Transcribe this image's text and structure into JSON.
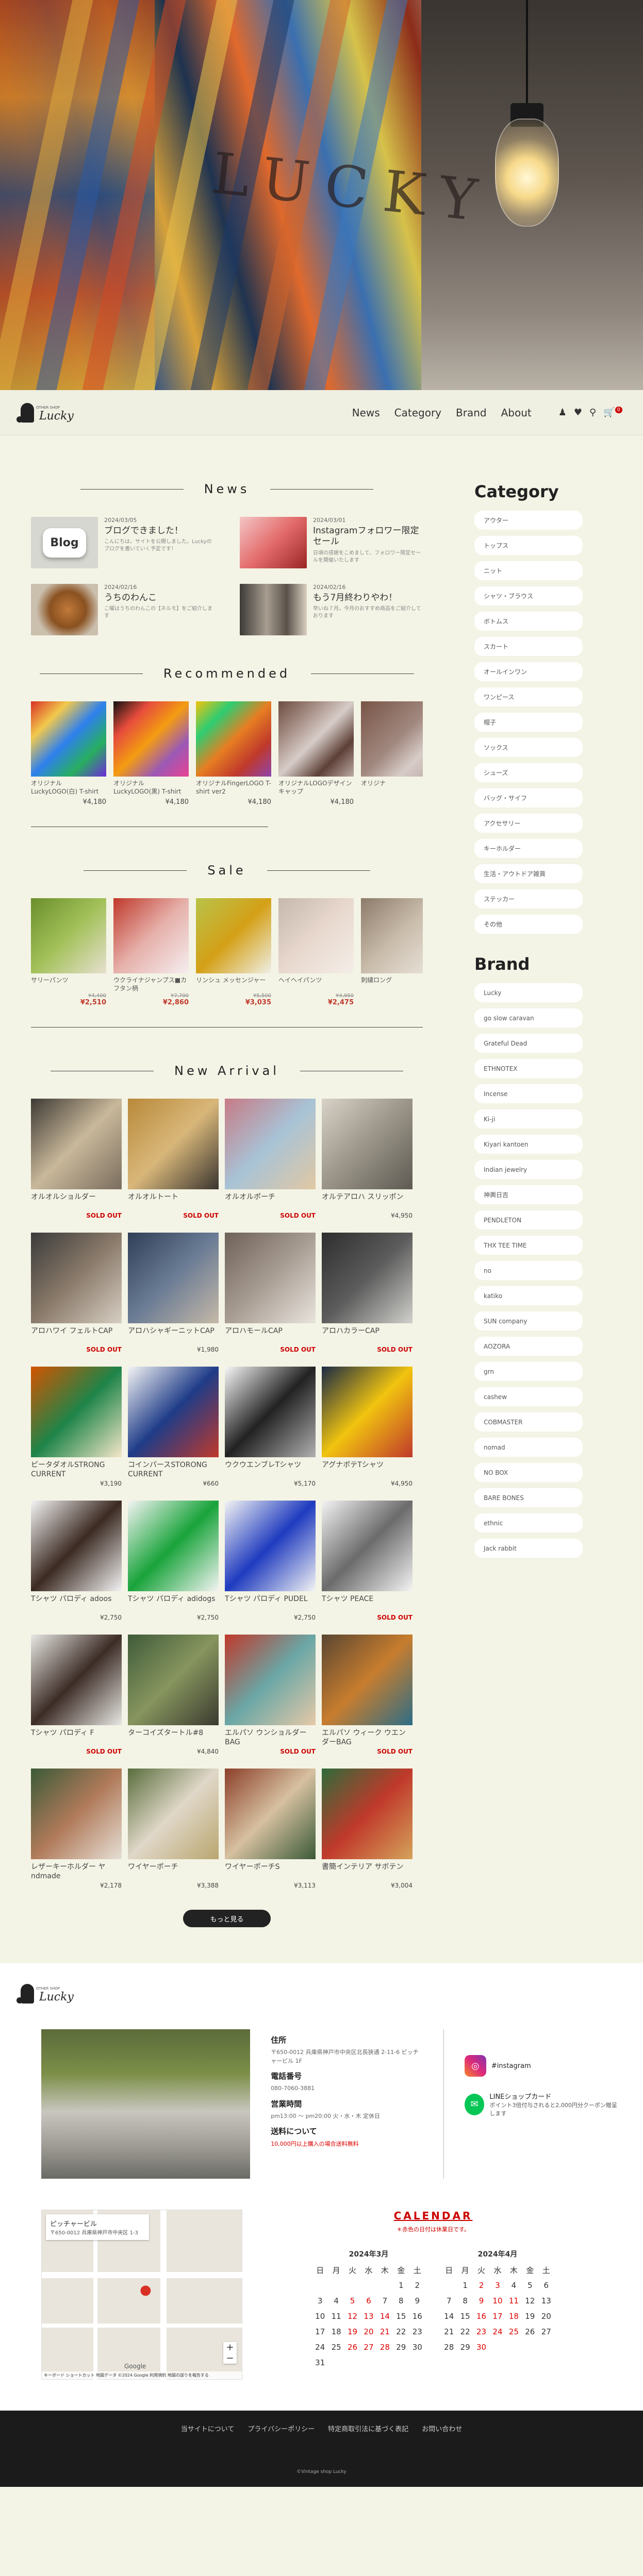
{
  "header": {
    "logo_text": "Lucky",
    "logo_sub": "OTHER SHOP",
    "nav": [
      "News",
      "Category",
      "Brand",
      "About"
    ],
    "cart_count": "0"
  },
  "hero": {
    "wall_text": "LUCKY"
  },
  "news": {
    "title": "News",
    "items": [
      {
        "date": "2024/03/05",
        "title": "ブログできました！",
        "desc": "こんにちは。サイトを公開しました。Luckyのブログを書いていく予定です！",
        "thumb": "blog",
        "thumb_text": "Blog"
      },
      {
        "date": "2024/03/01",
        "title": "Instagramフォロワー限定 セール",
        "desc": "日頃の感謝をこめまして、フォロワー限定セールを開催いたします",
        "thumb": "ig"
      },
      {
        "date": "2024/02/16",
        "title": "うちのわんこ",
        "desc": "こ曜はうちのわんこの【ネルモ】をご紹介します",
        "thumb": "dog"
      },
      {
        "date": "2024/02/16",
        "title": "もう7月終わりやわ！",
        "desc": "早いね７月。今月のおすすめ商品をご紹介しております",
        "thumb": "shop"
      }
    ]
  },
  "recommended": {
    "title": "Recommended",
    "items": [
      {
        "name": "オリジナルLuckyLOGO(白) T-shirt ver2",
        "price": "¥4,180",
        "colors": [
          "#d93025",
          "#f2c94c",
          "#2f80ed",
          "#27ae60",
          "#6c2bd9"
        ]
      },
      {
        "name": "オリジナルLuckyLOGO(黒) T-shirt ver2",
        "price": "¥4,180",
        "colors": [
          "#111",
          "#e74c3c",
          "#f39c12",
          "#9b59b6",
          "#e84393"
        ]
      },
      {
        "name": "オリジナルFingerLOGO T-shirt ver2",
        "price": "¥4,180",
        "colors": [
          "#f1c40f",
          "#2ecc71",
          "#e67e22",
          "#c0392b",
          "#8e44ad"
        ]
      },
      {
        "name": "オリジナルLOGOデザインキャップ",
        "price": "¥4,180",
        "colors": [
          "#6d4c41",
          "#a1887f",
          "#d7ccc8",
          "#5d4037",
          "#bcaaa4"
        ]
      },
      {
        "name": "オリジナ",
        "price": "",
        "colors": [
          "#795548",
          "#8d6e63",
          "#a1887f",
          "#d7ccc8",
          "#bcaaa4"
        ]
      }
    ]
  },
  "sale": {
    "title": "Sale",
    "items": [
      {
        "name": "サリーパンツ",
        "old": "¥4,400",
        "price": "¥2,510",
        "colors": [
          "#6b8f2c",
          "#a3c15a",
          "#e7e0cf"
        ]
      },
      {
        "name": "ウクライナジャンプス■カフタン柄",
        "old": "¥7,700",
        "price": "¥2,860",
        "colors": [
          "#c0392b",
          "#e6b0aa",
          "#f5eef0"
        ]
      },
      {
        "name": "リンシュ メッセンジャー",
        "old": "¥5,500",
        "price": "¥3,035",
        "colors": [
          "#b8c34a",
          "#d4a017",
          "#efefe6"
        ]
      },
      {
        "name": "ヘイヘイパンツ",
        "old": "¥4,950",
        "price": "¥2,475",
        "colors": [
          "#c6b8ad",
          "#e8d8ce",
          "#f4eee8"
        ]
      },
      {
        "name": "刺繍ロング",
        "old": "",
        "price": "",
        "colors": [
          "#8d7b6a",
          "#c9bcab",
          "#ece6de"
        ]
      }
    ]
  },
  "arrival": {
    "title": "New Arrival",
    "items": [
      {
        "name": "オルオルショルダー",
        "status": "SOLD OUT",
        "colors": [
          "#3e3a35",
          "#c9b89a",
          "#7a6d5e"
        ]
      },
      {
        "name": "オルオルトート",
        "status": "SOLD OUT",
        "colors": [
          "#b8893a",
          "#d9b77a",
          "#3a352f"
        ]
      },
      {
        "name": "オルオルポーチ",
        "status": "SOLD OUT",
        "colors": [
          "#c77b86",
          "#a8c3d6",
          "#e1c8a4"
        ]
      },
      {
        "name": "オルテアロハ スリッポン",
        "status": "¥4,950",
        "colors": [
          "#d8d2c8",
          "#9a9488",
          "#5e5a52"
        ]
      },
      {
        "name": "アロハワイ フェルトCAP",
        "status": "SOLD OUT",
        "colors": [
          "#3b3b3b",
          "#8a7a6a",
          "#d7cfc3"
        ]
      },
      {
        "name": "アロハシャギーニットCAP",
        "status": "¥1,980",
        "colors": [
          "#2f3f57",
          "#6b7c95",
          "#c5b9a8"
        ]
      },
      {
        "name": "アロハモールCAP",
        "status": "SOLD OUT",
        "colors": [
          "#6e6158",
          "#a89d93",
          "#e9e4dd"
        ]
      },
      {
        "name": "アロハカラーCAP",
        "status": "SOLD OUT",
        "colors": [
          "#2e2e2e",
          "#5c5c5c",
          "#d0d0cc"
        ]
      },
      {
        "name": "ピータダオルSTRONG CURRENT",
        "status": "¥3,190",
        "colors": [
          "#d35400",
          "#1e8449",
          "#f5e6c8"
        ]
      },
      {
        "name": "コインパースSTORONG CURRENT",
        "status": "¥660",
        "colors": [
          "#f4f4f4",
          "#1f3c88",
          "#c0392b"
        ]
      },
      {
        "name": "ウクウエンブレTシャツ",
        "status": "¥5,170",
        "colors": [
          "#f7f7f7",
          "#222",
          "#b0b0b0"
        ]
      },
      {
        "name": "アグナポテTシャツ",
        "status": "¥4,950",
        "colors": [
          "#1a2a44",
          "#f1c40f",
          "#c0392b"
        ]
      },
      {
        "name": "Tシャツ パロディ adoos",
        "status": "¥2,750",
        "colors": [
          "#f4f4f4",
          "#3b2a22",
          "#f4f4f4"
        ]
      },
      {
        "name": "Tシャツ パロディ adidogs",
        "status": "¥2,750",
        "colors": [
          "#f4f4f4",
          "#18a33a",
          "#f4f4f4"
        ]
      },
      {
        "name": "Tシャツ パロディ PUDEL",
        "status": "¥2,750",
        "colors": [
          "#f4f4f4",
          "#1f3bbf",
          "#f4f4f4"
        ]
      },
      {
        "name": "Tシャツ PEACE",
        "status": "SOLD OUT",
        "colors": [
          "#f4f4f4",
          "#6b6b6b",
          "#f4f4f4"
        ]
      },
      {
        "name": "Tシャツ パロディ F",
        "status": "SOLD OUT",
        "colors": [
          "#e8e8e4",
          "#3d2c26",
          "#e8e8e4"
        ]
      },
      {
        "name": "ターコイズタートル#8",
        "status": "¥4,840",
        "colors": [
          "#3f5b3a",
          "#87955e",
          "#3a3a2f"
        ]
      },
      {
        "name": "エルパソ ウンショルダーBAG",
        "status": "SOLD OUT",
        "colors": [
          "#c0392b",
          "#6aa7a6",
          "#e6c9a8"
        ]
      },
      {
        "name": "エルパソ ウィーク ウエンダーBAG",
        "status": "SOLD OUT",
        "colors": [
          "#5a4632",
          "#c77d2e",
          "#2d6d86"
        ]
      },
      {
        "name": "レザーキーホルダー ヤndmade",
        "status": "¥2,178",
        "colors": [
          "#3b5a38",
          "#b07a5a",
          "#e6dfd5"
        ]
      },
      {
        "name": "ワイヤーポーチ",
        "status": "¥3,388",
        "colors": [
          "#5a6e3d",
          "#e0d7c8",
          "#b9a66f"
        ]
      },
      {
        "name": "ワイヤーポーチS",
        "status": "¥3,113",
        "colors": [
          "#8c3f2a",
          "#d6c0a0",
          "#3b5a38"
        ]
      },
      {
        "name": "書簡インテリア サボテン",
        "status": "¥3,004",
        "colors": [
          "#2f6b3a",
          "#c0392b",
          "#d4a35a"
        ]
      }
    ],
    "more_label": "もっと見る"
  },
  "sidebar": {
    "category_title": "Category",
    "categories": [
      "アウター",
      "トップス",
      "ニット",
      "シャツ・ブラウス",
      "ボトムス",
      "スカート",
      "オールインワン",
      "ワンピース",
      "帽子",
      "ソックス",
      "シューズ",
      "バッグ・サイフ",
      "アクセサリー",
      "キーホルダー",
      "生活・アウトドア雑貨",
      "ステッカー",
      "その他"
    ],
    "brand_title": "Brand",
    "brands": [
      "Lucky",
      "go slow caravan",
      "Grateful Dead",
      "ETHNOTEX",
      "Incense",
      "Ki-ji",
      "Kiyari kantoen",
      "Indian jewelry",
      "神輿日吉",
      "PENDLETON",
      "THX TEE TIME",
      "no",
      "katiko",
      "SUN company",
      "AOZORA",
      "grn",
      "cashew",
      "COBMASTER",
      "nomad",
      "NO BOX",
      "BARE BONES",
      "ethnic",
      "Jack rabbit"
    ]
  },
  "footer": {
    "address_h": "住所",
    "address": "〒650-0012 兵庫県神戸市中央区北長狭通 2-11-6 ピッチャービル 1F",
    "tel_h": "電話番号",
    "tel": "080-7060-3881",
    "hours_h": "営業時間",
    "hours": "pm13:00 ～ pm20:00 火・水・木 定休日",
    "shipping_h": "送料について",
    "shipping": "10,000円以上購入の場合送料無料",
    "instagram": "#instagram",
    "line": "LINEショップカード",
    "line_sub": "ポイント3倍付与されると2,000円分クーポン贈呈します",
    "map_title": "ピッチャービル",
    "map_sub": "〒650-0012 兵庫県神戸市中央区 1-3",
    "map_terms": "キーボード ショートカット 地図データ ©2024 Google 利用規約 地図の誤りを報告する",
    "calendar_title": "CALENDAR",
    "calendar_note": "＊赤色の日付は休業日です。",
    "cal1_title": "2024年3月",
    "cal2_title": "2024年4月",
    "weekdays": [
      "日",
      "月",
      "火",
      "水",
      "木",
      "金",
      "土"
    ],
    "links": [
      "当サイトについて",
      "プライバシーポリシー",
      "特定商取引法に基づく表記",
      "お問い合わせ"
    ],
    "copy": "©Vintage shop Lucky"
  }
}
